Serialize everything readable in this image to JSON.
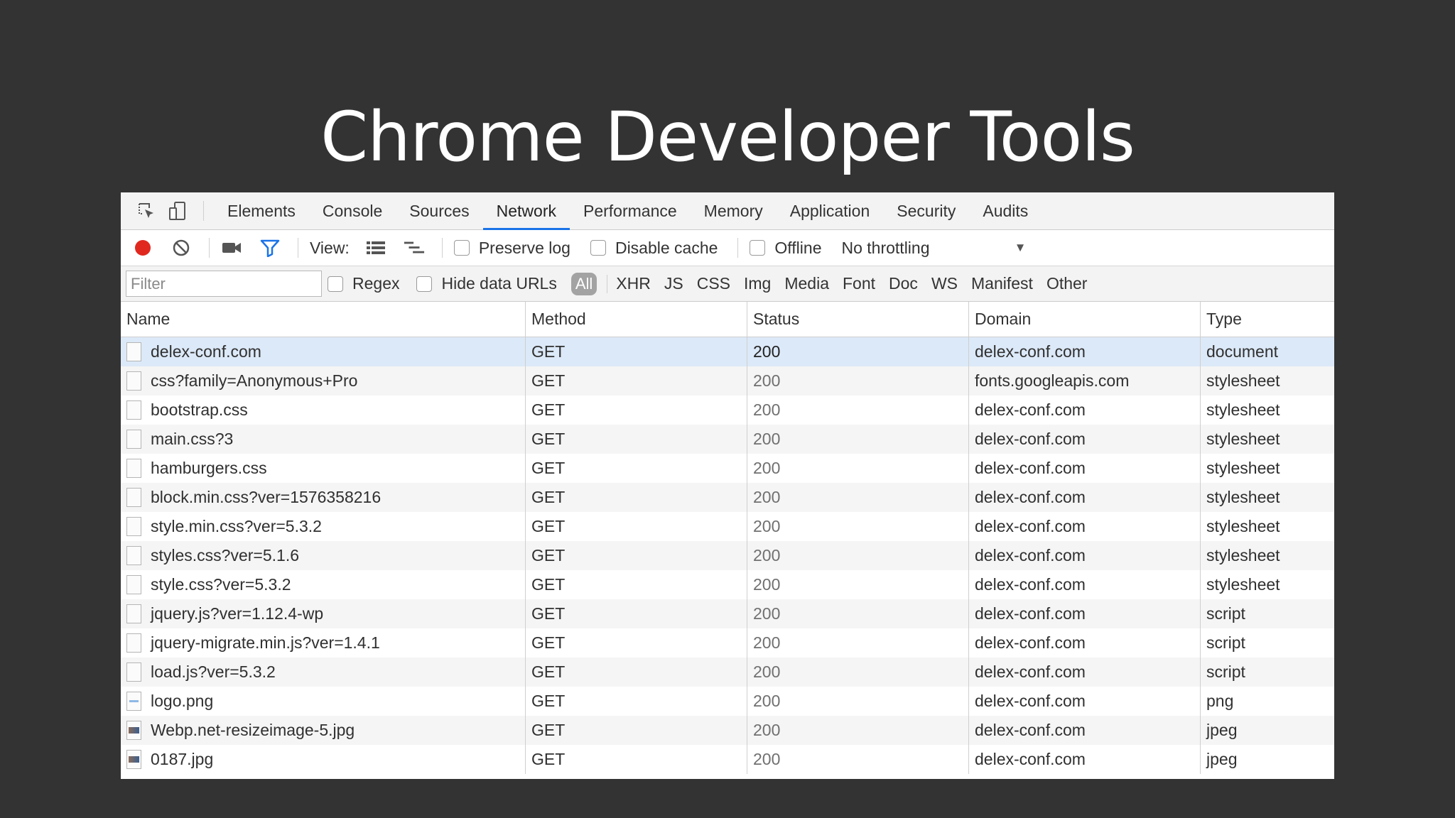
{
  "slide": {
    "title": "Chrome Developer Tools"
  },
  "tabs": [
    {
      "label": "Elements"
    },
    {
      "label": "Console"
    },
    {
      "label": "Sources"
    },
    {
      "label": "Network",
      "active": true
    },
    {
      "label": "Performance"
    },
    {
      "label": "Memory"
    },
    {
      "label": "Application"
    },
    {
      "label": "Security"
    },
    {
      "label": "Audits"
    }
  ],
  "toolbar": {
    "icons": [
      "record-icon",
      "clear-icon",
      "camera-icon",
      "filter-icon",
      "list-view-icon",
      "waterfall-view-icon"
    ],
    "view_label": "View:",
    "preserve_log": "Preserve log",
    "disable_cache": "Disable cache",
    "offline": "Offline",
    "throttling": "No throttling"
  },
  "filterbar": {
    "placeholder": "Filter",
    "regex": "Regex",
    "hide_data_urls": "Hide data URLs",
    "all": "All",
    "types": [
      "XHR",
      "JS",
      "CSS",
      "Img",
      "Media",
      "Font",
      "Doc",
      "WS",
      "Manifest",
      "Other"
    ]
  },
  "table": {
    "columns": [
      "Name",
      "Method",
      "Status",
      "Domain",
      "Type"
    ],
    "rows": [
      {
        "name": "delex-conf.com",
        "method": "GET",
        "status": "200",
        "domain": "delex-conf.com",
        "type": "document",
        "icon": "doc"
      },
      {
        "name": "css?family=Anonymous+Pro",
        "method": "GET",
        "status": "200",
        "domain": "fonts.googleapis.com",
        "type": "stylesheet",
        "icon": "doc"
      },
      {
        "name": "bootstrap.css",
        "method": "GET",
        "status": "200",
        "domain": "delex-conf.com",
        "type": "stylesheet",
        "icon": "doc"
      },
      {
        "name": "main.css?3",
        "method": "GET",
        "status": "200",
        "domain": "delex-conf.com",
        "type": "stylesheet",
        "icon": "doc"
      },
      {
        "name": "hamburgers.css",
        "method": "GET",
        "status": "200",
        "domain": "delex-conf.com",
        "type": "stylesheet",
        "icon": "doc"
      },
      {
        "name": "block.min.css?ver=1576358216",
        "method": "GET",
        "status": "200",
        "domain": "delex-conf.com",
        "type": "stylesheet",
        "icon": "doc"
      },
      {
        "name": "style.min.css?ver=5.3.2",
        "method": "GET",
        "status": "200",
        "domain": "delex-conf.com",
        "type": "stylesheet",
        "icon": "doc"
      },
      {
        "name": "styles.css?ver=5.1.6",
        "method": "GET",
        "status": "200",
        "domain": "delex-conf.com",
        "type": "stylesheet",
        "icon": "doc"
      },
      {
        "name": "style.css?ver=5.3.2",
        "method": "GET",
        "status": "200",
        "domain": "delex-conf.com",
        "type": "stylesheet",
        "icon": "doc"
      },
      {
        "name": "jquery.js?ver=1.12.4-wp",
        "method": "GET",
        "status": "200",
        "domain": "delex-conf.com",
        "type": "script",
        "icon": "doc"
      },
      {
        "name": "jquery-migrate.min.js?ver=1.4.1",
        "method": "GET",
        "status": "200",
        "domain": "delex-conf.com",
        "type": "script",
        "icon": "doc"
      },
      {
        "name": "load.js?ver=5.3.2",
        "method": "GET",
        "status": "200",
        "domain": "delex-conf.com",
        "type": "script",
        "icon": "doc"
      },
      {
        "name": "logo.png",
        "method": "GET",
        "status": "200",
        "domain": "delex-conf.com",
        "type": "png",
        "icon": "png"
      },
      {
        "name": "Webp.net-resizeimage-5.jpg",
        "method": "GET",
        "status": "200",
        "domain": "delex-conf.com",
        "type": "jpeg",
        "icon": "img"
      },
      {
        "name": "0187.jpg",
        "method": "GET",
        "status": "200",
        "domain": "delex-conf.com",
        "type": "jpeg",
        "icon": "img"
      }
    ]
  },
  "colors": {
    "slide_bg": "#333333",
    "active_tab_underline": "#1a73e8",
    "record": "#e0281f",
    "filter_icon": "#1a73e8",
    "selected_row": "#dce9f8"
  }
}
